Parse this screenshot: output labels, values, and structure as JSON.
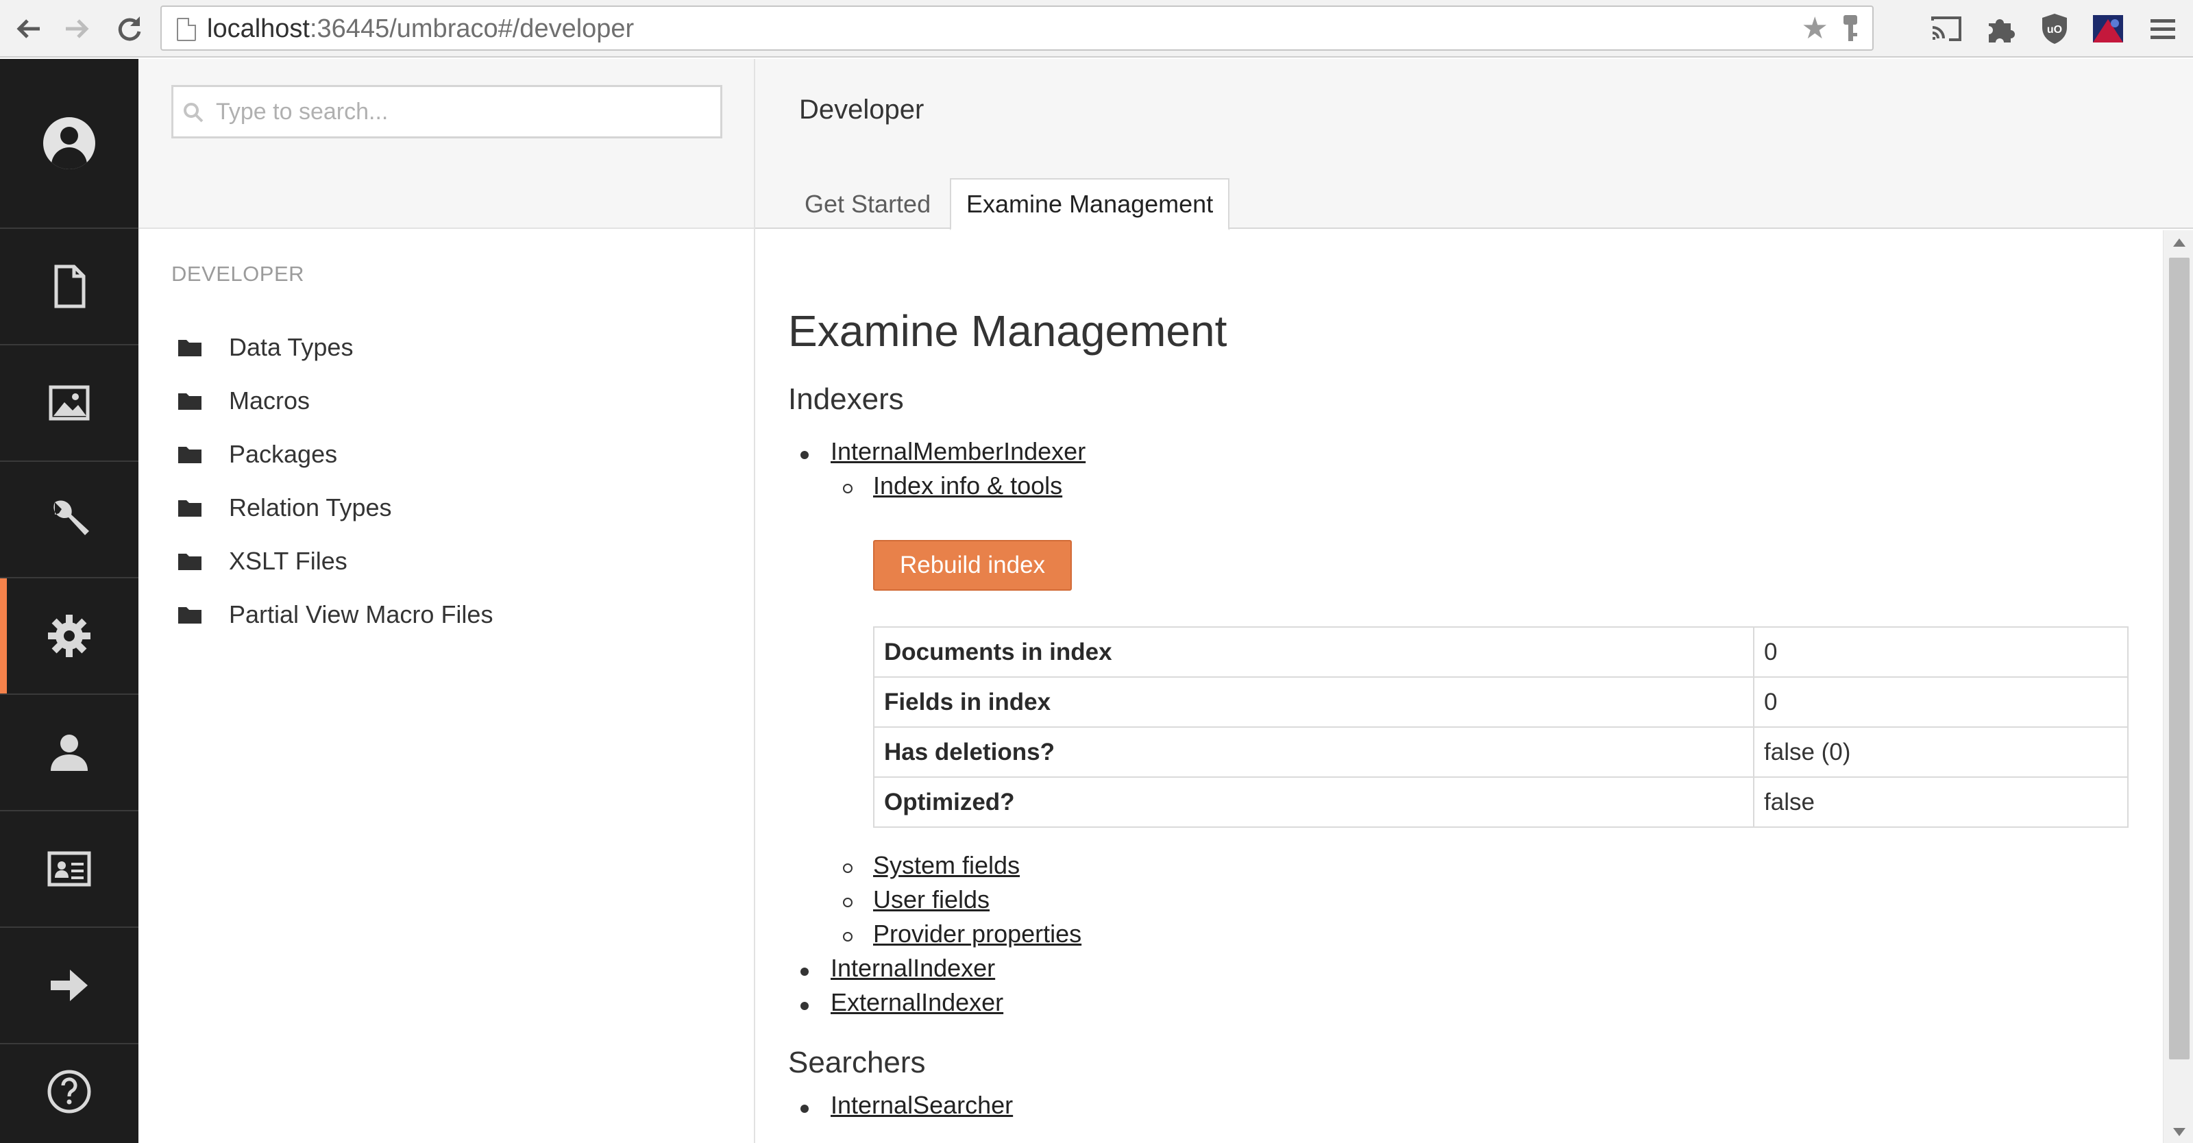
{
  "browser": {
    "url_host": "localhost",
    "url_rest": ":36445/umbraco#/developer",
    "icons": [
      "back-icon",
      "forward-icon",
      "reload-icon",
      "page-icon",
      "star-icon",
      "key-icon",
      "cast-icon",
      "extension-icon",
      "ublock-icon",
      "profile-icon",
      "menu-icon"
    ]
  },
  "sections": {
    "items": [
      "content",
      "media",
      "settings",
      "developer",
      "users",
      "members",
      "forms"
    ],
    "active": "developer",
    "accent_color": "#f5824b"
  },
  "tree": {
    "search_placeholder": "Type to search...",
    "title": "DEVELOPER",
    "items": [
      {
        "label": "Data Types"
      },
      {
        "label": "Macros"
      },
      {
        "label": "Packages"
      },
      {
        "label": "Relation Types"
      },
      {
        "label": "XSLT Files"
      },
      {
        "label": "Partial View Macro Files"
      }
    ]
  },
  "editor": {
    "title": "Developer",
    "tabs": [
      {
        "label": "Get Started"
      },
      {
        "label": "Examine Management"
      }
    ],
    "active_tab": "Examine Management"
  },
  "examine": {
    "heading": "Examine Management",
    "indexers_heading": "Indexers",
    "indexer1": "InternalMemberIndexer",
    "index_info_link": "Index info & tools",
    "rebuild_label": "Rebuild index",
    "stats": [
      {
        "key": "Documents in index",
        "value": "0"
      },
      {
        "key": "Fields in index",
        "value": "0"
      },
      {
        "key": "Has deletions?",
        "value": "false (0)"
      },
      {
        "key": "Optimized?",
        "value": "false"
      }
    ],
    "sub_links": [
      "System fields",
      "User fields",
      "Provider properties"
    ],
    "indexer2": "InternalIndexer",
    "indexer3": "ExternalIndexer",
    "searchers_heading": "Searchers",
    "searcher1": "InternalSearcher"
  }
}
